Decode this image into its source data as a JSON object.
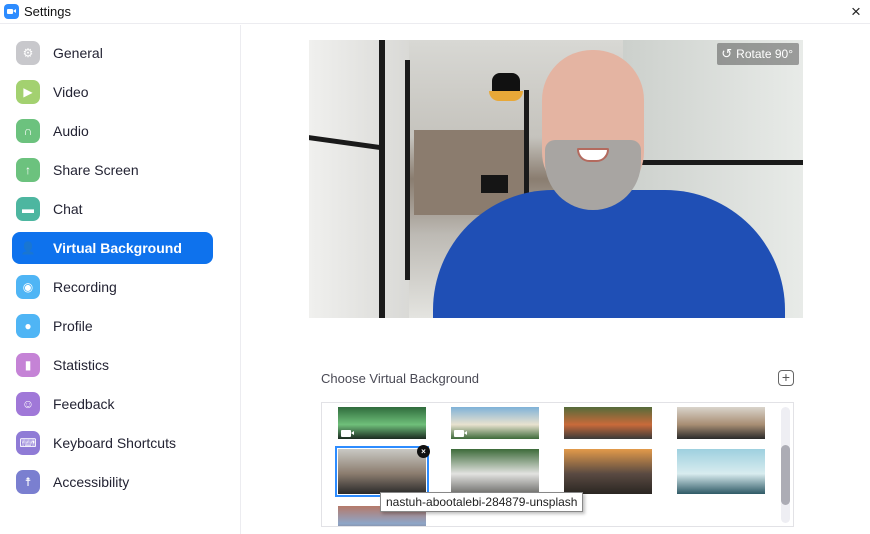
{
  "window": {
    "title": "Settings",
    "close_icon": "×"
  },
  "sidebar": {
    "items": [
      {
        "label": "General",
        "icon": "gear-icon",
        "color": "#c8c8cc",
        "glyph": "⚙",
        "active": false
      },
      {
        "label": "Video",
        "icon": "video-camera-icon",
        "color": "#a3d170",
        "glyph": "▶",
        "active": false
      },
      {
        "label": "Audio",
        "icon": "headphones-icon",
        "color": "#6cc27e",
        "glyph": "∩",
        "active": false
      },
      {
        "label": "Share Screen",
        "icon": "share-screen-icon",
        "color": "#6cc27e",
        "glyph": "↑",
        "active": false
      },
      {
        "label": "Chat",
        "icon": "chat-bubble-icon",
        "color": "#4db6a0",
        "glyph": "▬",
        "active": false
      },
      {
        "label": "Virtual Background",
        "icon": "person-card-icon",
        "color": "#0e72ed",
        "glyph": "👤",
        "active": true
      },
      {
        "label": "Recording",
        "icon": "record-icon",
        "color": "#4fb5f5",
        "glyph": "◉",
        "active": false
      },
      {
        "label": "Profile",
        "icon": "profile-icon",
        "color": "#4fb5f5",
        "glyph": "●",
        "active": false
      },
      {
        "label": "Statistics",
        "icon": "bar-chart-icon",
        "color": "#c583d6",
        "glyph": "▮",
        "active": false
      },
      {
        "label": "Feedback",
        "icon": "smiley-icon",
        "color": "#a078d8",
        "glyph": "☺",
        "active": false
      },
      {
        "label": "Keyboard Shortcuts",
        "icon": "keyboard-icon",
        "color": "#8f7bd6",
        "glyph": "⌨",
        "active": false
      },
      {
        "label": "Accessibility",
        "icon": "accessibility-icon",
        "color": "#7a7fd0",
        "glyph": "☨",
        "active": false
      }
    ]
  },
  "preview": {
    "rotate_label": "Rotate 90°",
    "rotate_icon": "↺"
  },
  "backgrounds": {
    "section_label": "Choose Virtual Background",
    "add_icon": "+",
    "items": [
      {
        "name": "aurora",
        "colors": [
          "#2f6b3c",
          "#6fbf7a",
          "#1b2a20"
        ],
        "video": true,
        "selected": false
      },
      {
        "name": "beach",
        "colors": [
          "#7fb2d8",
          "#e8e2cf",
          "#3d6a3a"
        ],
        "video": true,
        "selected": false
      },
      {
        "name": "highway",
        "colors": [
          "#556b3a",
          "#c96a3a",
          "#3a3a3a"
        ],
        "video": false,
        "selected": false
      },
      {
        "name": "hallway",
        "colors": [
          "#d9d4cc",
          "#a88e74",
          "#2a2a2a"
        ],
        "video": false,
        "selected": false
      },
      {
        "name": "nastuh-abootalebi-284879-unsplash",
        "colors": [
          "#c9c9c4",
          "#8b7c6e",
          "#2a2a2a"
        ],
        "video": false,
        "selected": true
      },
      {
        "name": "conference-room",
        "colors": [
          "#3d6b3a",
          "#e2e2e0",
          "#6d6d6a"
        ],
        "video": false,
        "selected": false
      },
      {
        "name": "city-sunset",
        "colors": [
          "#e39a4a",
          "#5a4a42",
          "#2a2622"
        ],
        "video": false,
        "selected": false
      },
      {
        "name": "skyline",
        "colors": [
          "#9ed0df",
          "#d8ecef",
          "#2f5a66"
        ],
        "video": false,
        "selected": false
      },
      {
        "name": "cherry-blossom",
        "colors": [
          "#b57a6a",
          "#8ea6c8",
          "#6b4a40"
        ],
        "video": false,
        "selected": false
      }
    ],
    "delete_icon": "×",
    "tooltip": "nastuh-abootalebi-284879-unsplash"
  }
}
